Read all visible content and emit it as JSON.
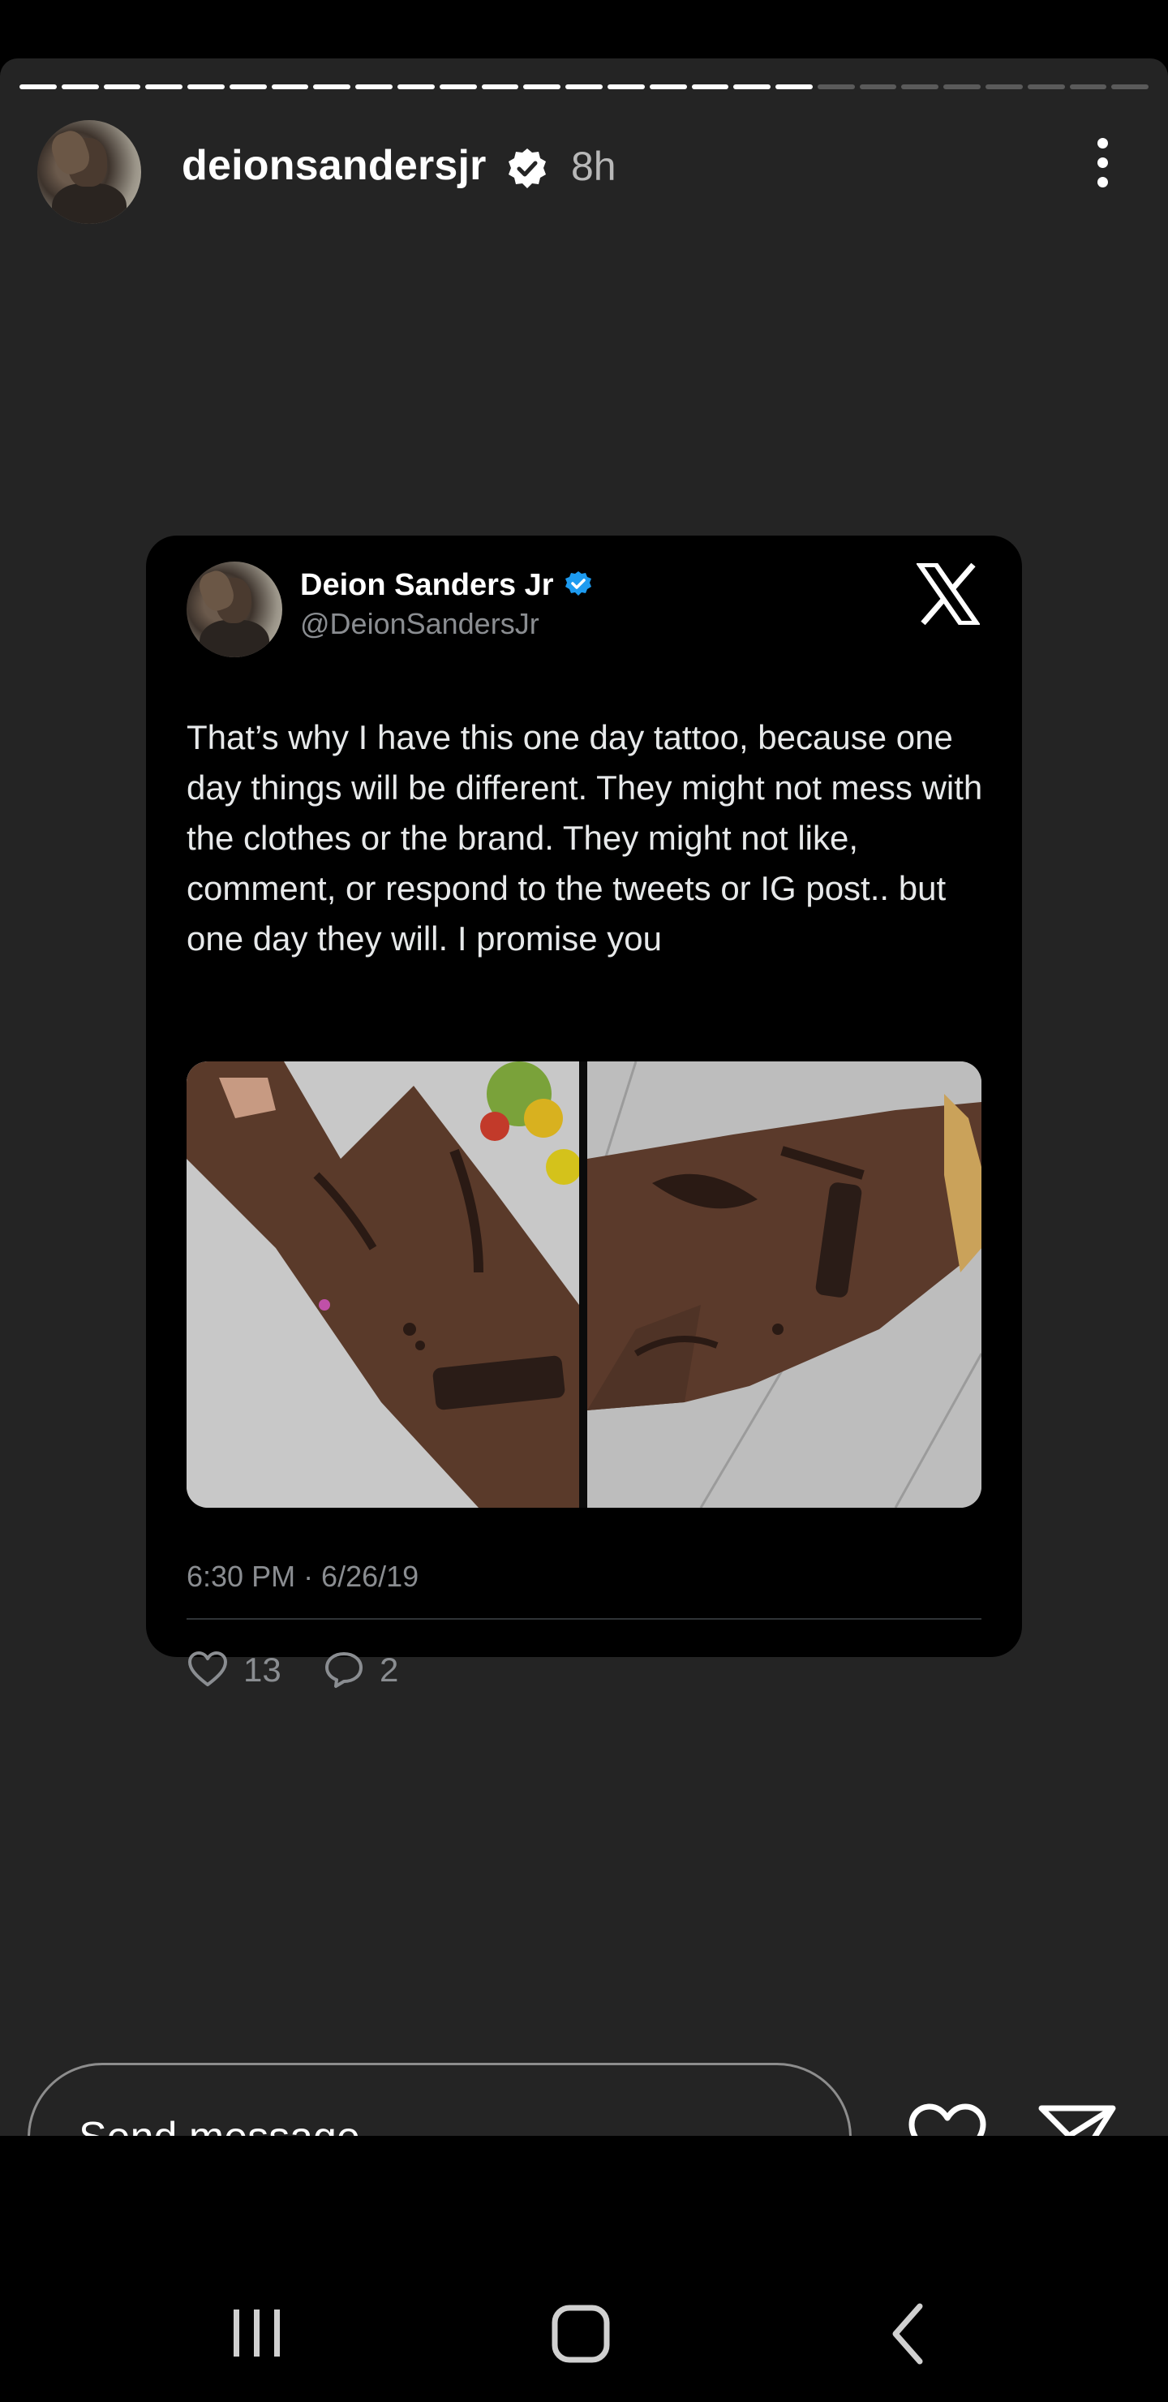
{
  "story": {
    "progress": {
      "total_segments": 27,
      "viewed_segments": 19
    },
    "header": {
      "username": "deionsandersjr",
      "verified": true,
      "time_ago": "8h",
      "more_icon": "more-vertical-icon"
    }
  },
  "tweet": {
    "display_name": "Deion Sanders Jr",
    "handle": "@DeionSandersJr",
    "platform_icon": "x-logo-icon",
    "text": "That’s why I have this one day tattoo, because one day things will be different. They might not mess with the clothes or the brand. They might not like, comment, or respond to the tweets or IG post.. but one day they will. I promise you",
    "timestamp": "6:30 PM · 6/26/19",
    "likes": "13",
    "replies": "2",
    "colors": {
      "verified_badge": "#1d9bf0",
      "card_bg": "#000000"
    }
  },
  "composer": {
    "placeholder": "Send message",
    "like_icon": "heart-icon",
    "share_icon": "send-icon"
  },
  "navbar": {
    "recents_icon": "recent-apps-icon",
    "home_icon": "home-icon",
    "back_icon": "back-icon"
  }
}
